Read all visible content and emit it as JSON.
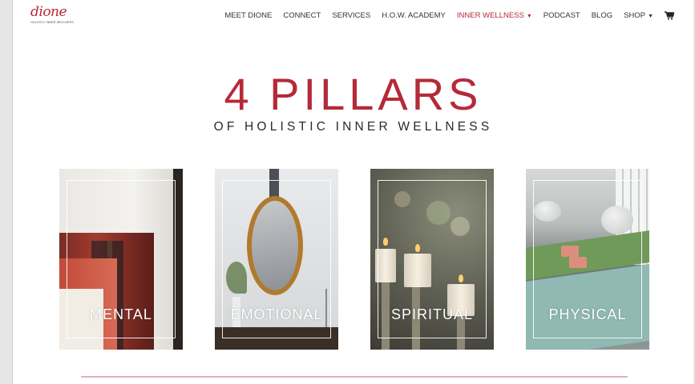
{
  "brand": {
    "logo_text": "dione",
    "logo_tagline": "HOLISTIC INNER WELLNESS",
    "accent_color": "#b52a38"
  },
  "nav": {
    "items": [
      {
        "label": "MEET DIONE"
      },
      {
        "label": "CONNECT"
      },
      {
        "label": "SERVICES"
      },
      {
        "label": "H.O.W. ACADEMY"
      },
      {
        "label": "INNER WELLNESS",
        "active": true,
        "has_dropdown": true
      },
      {
        "label": "PODCAST"
      },
      {
        "label": "BLOG"
      },
      {
        "label": "SHOP",
        "has_dropdown": true
      }
    ],
    "cart_icon": "shopping-cart-icon"
  },
  "hero": {
    "title": "4 PILLARS",
    "subtitle": "OF HOLISTIC INNER WELLNESS"
  },
  "pillars": [
    {
      "label": "MENTAL"
    },
    {
      "label": "EMOTIONAL"
    },
    {
      "label": "SPIRITUAL"
    },
    {
      "label": "PHYSICAL"
    }
  ]
}
